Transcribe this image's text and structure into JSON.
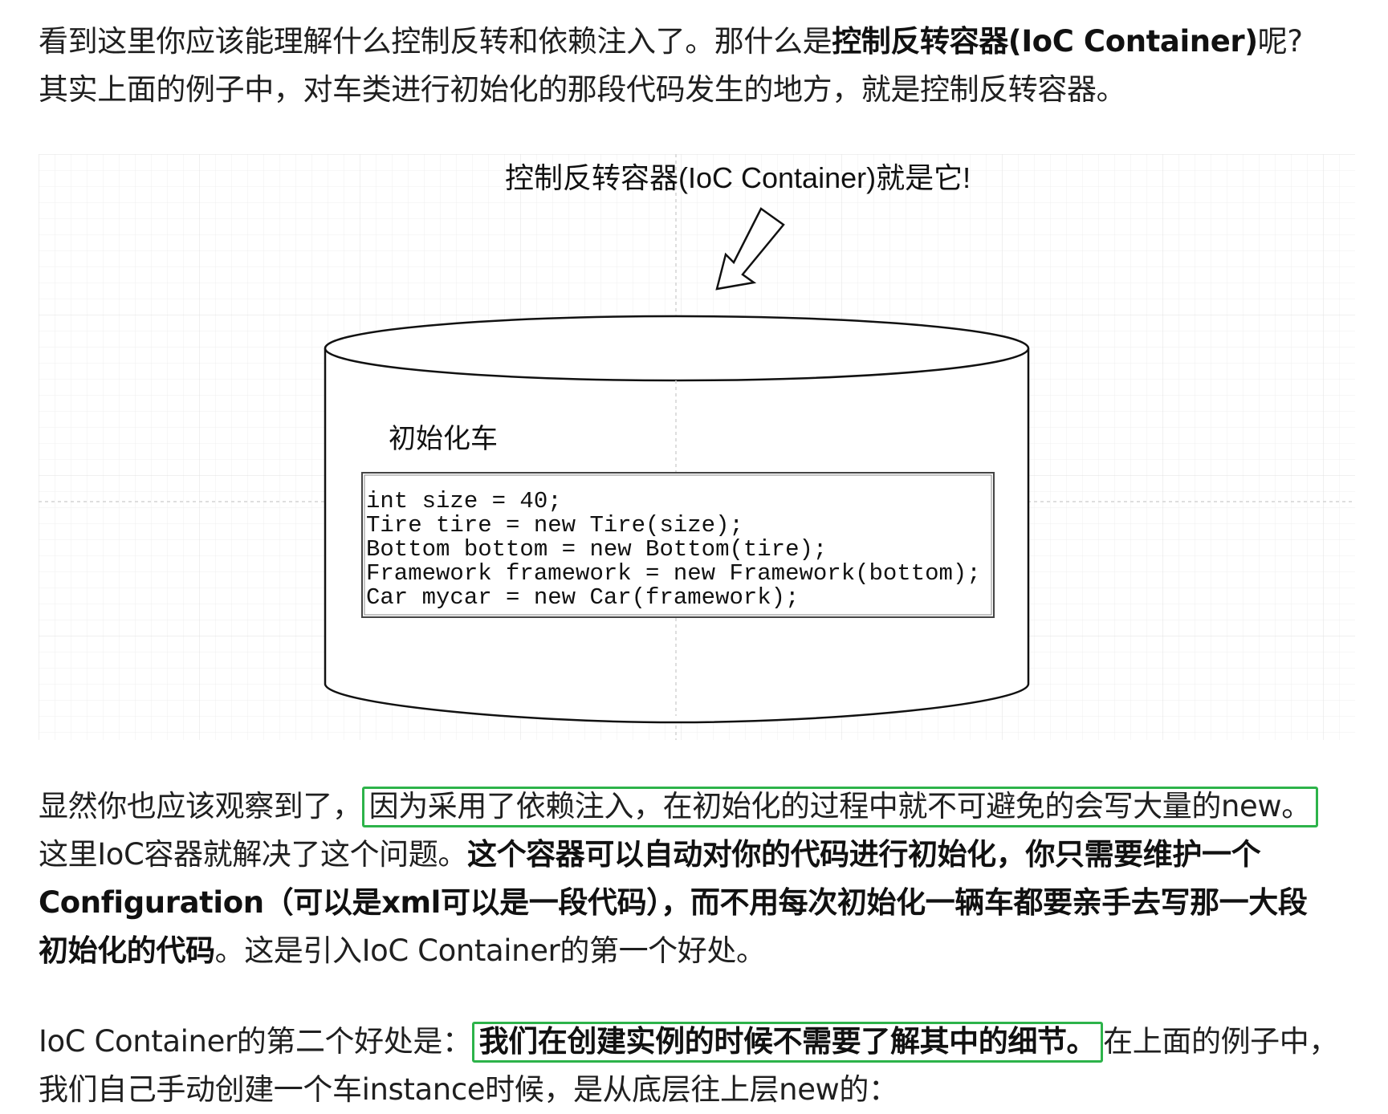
{
  "intro": {
    "line1_part1": "看到这里你应该能理解什么控制反转和依赖注入了。那什么是",
    "line1_bold": "控制反转容器(IoC Container)",
    "line1_part2": "呢?",
    "line2": "其实上面的例子中，对车类进行初始化的那段代码发生的地方，就是控制反转容器。"
  },
  "diagram": {
    "caption": "控制反转容器(IoC Container)就是它!",
    "box_title": "初始化车",
    "code_lines": [
      "int size = 40;",
      "Tire tire = new Tire(size);",
      "Bottom bottom = new Bottom(tire);",
      "Framework framework = new Framework(bottom);",
      "Car mycar = new Car(framework);"
    ]
  },
  "para2": {
    "line1_part1": "显然你也应该观察到了，",
    "line1_highlight": "因为采用了依赖注入，在初始化的过程中就不可避免的会写大量的new。",
    "line2_part1": "这里IoC容器就解决了这个问题。",
    "line2_bold": "这个容器可以自动对你的代码进行初始化，你只需要维护一个",
    "line3_bold": "Configuration（可以是xml可以是一段代码），而不用每次初始化一辆车都要亲手去写那一大段",
    "line4_bold": "初始化的代码",
    "line4_part2": "。这是引入IoC Container的第一个好处。"
  },
  "para3": {
    "line1_part1": "IoC Container的第二个好处是：",
    "line1_highlight": "我们在创建实例的时候不需要了解其中的细节。",
    "line1_part2": "在上面的例子中，",
    "line2": "我们自己手动创建一个车instance时候，是从底层往上层new的："
  },
  "colors": {
    "highlight_border": "#2db34a",
    "text": "#1f1f1f",
    "grid": "#e6e6e6"
  }
}
